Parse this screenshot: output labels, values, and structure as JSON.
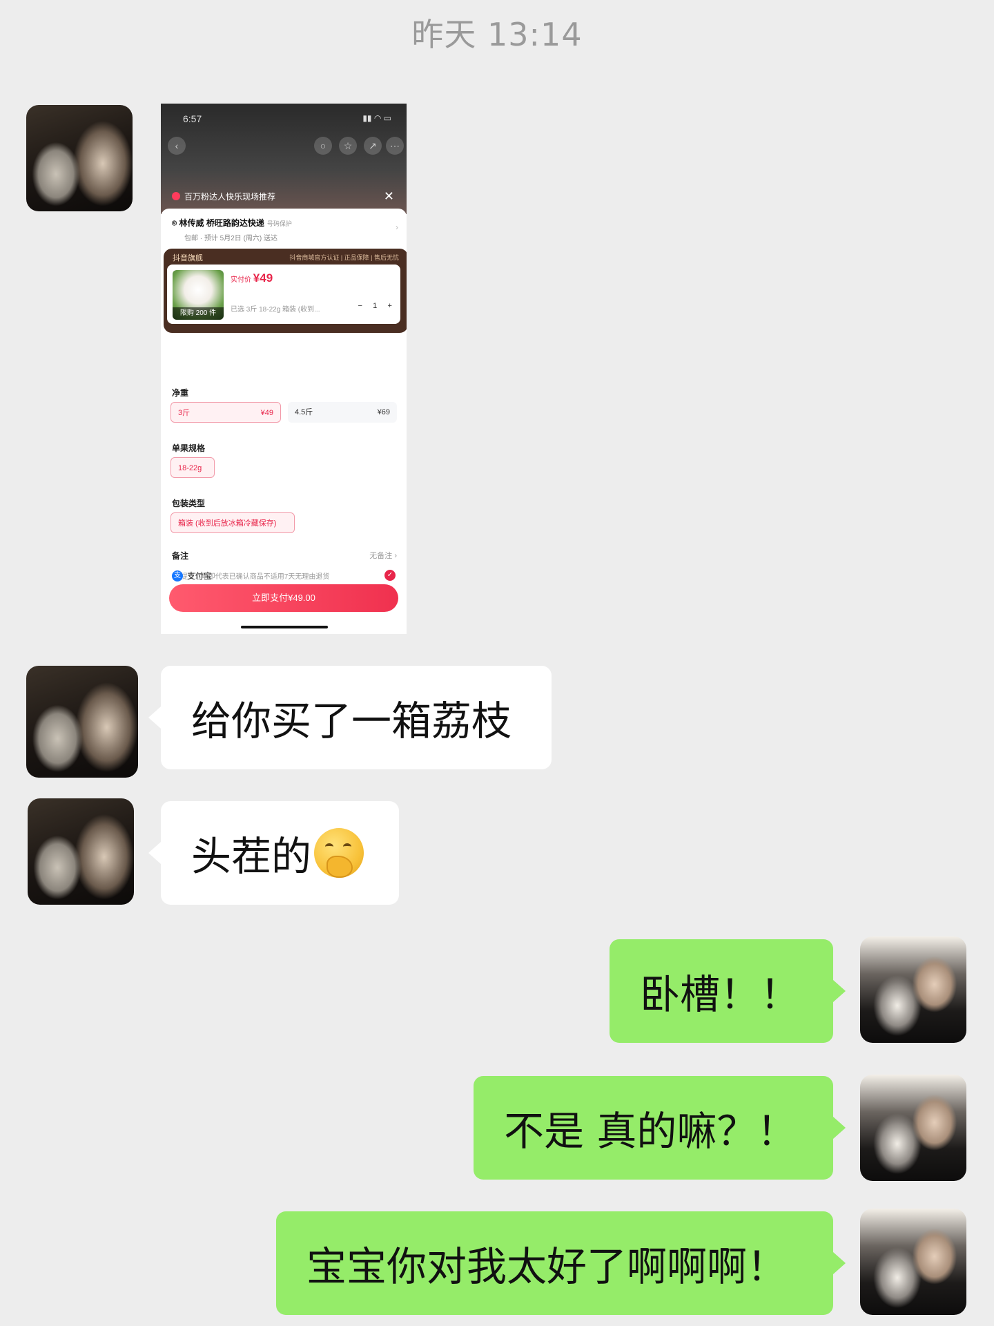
{
  "timestamp": "昨天 13:14",
  "messages": [
    {
      "side": "left",
      "text": "给你买了一箱荔枝"
    },
    {
      "side": "left",
      "text": "头茬的",
      "emoji": "face-with-hand-over-mouth"
    },
    {
      "side": "right",
      "text": "卧槽！！"
    },
    {
      "side": "right",
      "text": "不是 真的嘛？！"
    },
    {
      "side": "right",
      "text": "宝宝你对我太好了啊啊啊！"
    }
  ],
  "shared_screenshot": {
    "time": "6:57",
    "live_banner": "百万粉达人快乐现场推荐",
    "address": "林传威  桥旺路韵达快递",
    "address_tag": "号码保护",
    "delivery": "包邮 · 预计 5月2日 (周六) 送达",
    "store_label": "抖音旗舰",
    "store_badges": "抖音商城官方认证 | 正品保障 | 售后无忧",
    "price_label": "实付价",
    "price": "¥49",
    "limit": "限购 200 件",
    "selected_spec": "已选 3斤 18-22g 箱装 (收到...",
    "quantity": "1",
    "net_weight_title": "净重",
    "weight_options": [
      {
        "label": "3斤",
        "price": "¥49",
        "selected": true
      },
      {
        "label": "4.5斤",
        "price": "¥69",
        "selected": false
      }
    ],
    "size_title": "单果规格",
    "size_option": "18-22g",
    "package_title": "包装类型",
    "package_option": "箱装 (收到后放冰箱冷藏保存)",
    "remark_title": "备注",
    "remark_value": "无备注 ›",
    "notice": "ⓘ 提交订单即代表已确认商品不适用7天无理由退货",
    "payment_method": "支付宝",
    "pay_button": "立即支付¥49.00"
  },
  "colors": {
    "background": "#ededed",
    "bubble_left": "#ffffff",
    "bubble_right": "#95ec69",
    "price_red": "#e8254a"
  }
}
